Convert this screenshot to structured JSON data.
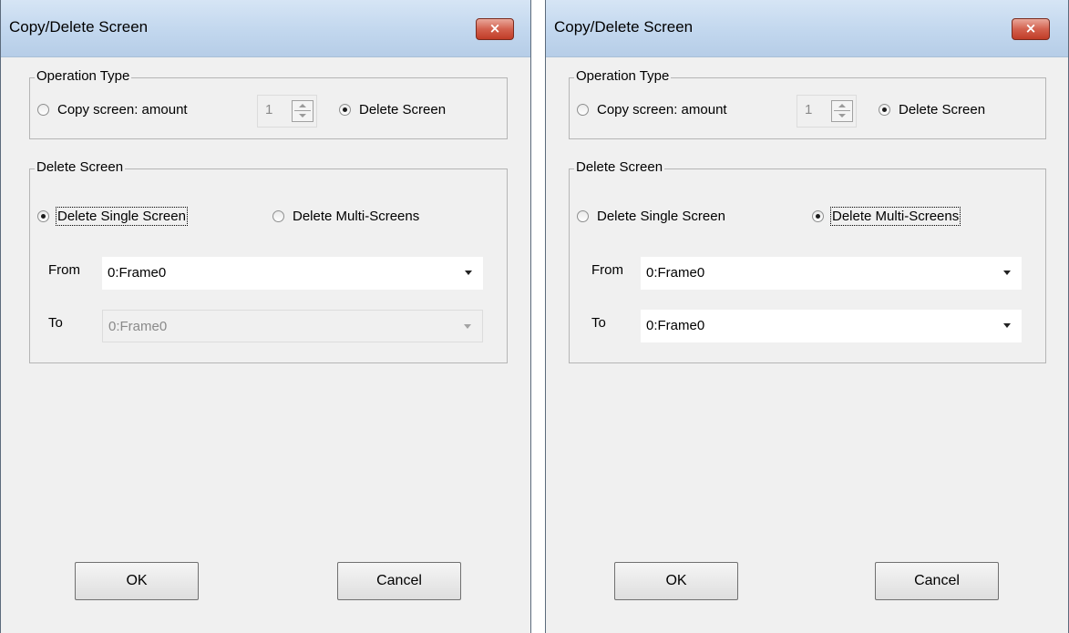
{
  "dialogs": [
    {
      "title": "Copy/Delete Screen",
      "close_icon": "×",
      "operation_group": {
        "legend": "Operation Type",
        "copy_label": "Copy screen: amount",
        "copy_checked": false,
        "amount": "1",
        "delete_label": "Delete Screen",
        "delete_checked": true
      },
      "delete_group": {
        "legend": "Delete Screen",
        "single_label": "Delete Single Screen",
        "single_checked": true,
        "multi_label": "Delete Multi-Screens",
        "multi_checked": false,
        "from_label": "From",
        "from_value": "0:Frame0",
        "to_label": "To",
        "to_value": "0:Frame0",
        "to_enabled": false
      },
      "buttons": {
        "ok": "OK",
        "cancel": "Cancel"
      }
    },
    {
      "title": "Copy/Delete Screen",
      "close_icon": "×",
      "operation_group": {
        "legend": "Operation Type",
        "copy_label": "Copy screen: amount",
        "copy_checked": false,
        "amount": "1",
        "delete_label": "Delete Screen",
        "delete_checked": true
      },
      "delete_group": {
        "legend": "Delete Screen",
        "single_label": "Delete Single Screen",
        "single_checked": false,
        "multi_label": "Delete Multi-Screens",
        "multi_checked": true,
        "from_label": "From",
        "from_value": "0:Frame0",
        "to_label": "To",
        "to_value": "0:Frame0",
        "to_enabled": true
      },
      "buttons": {
        "ok": "OK",
        "cancel": "Cancel"
      }
    }
  ],
  "icons": {
    "close": "close-icon",
    "radio": "radio-icon",
    "spin_up": "arrow-up-icon",
    "spin_down": "arrow-down-icon",
    "dropdown": "chevron-down-icon"
  },
  "colors": {
    "title_gradient_top": "#d6e5f5",
    "close_button": "#c03c27",
    "dialog_background": "#f0f0f0"
  }
}
